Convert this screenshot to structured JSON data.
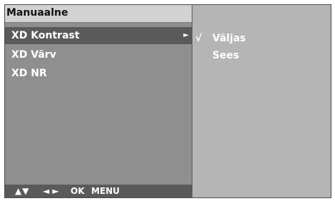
{
  "title": "Manuaalne",
  "menu": {
    "items": [
      {
        "label": "XD Kontrast",
        "selected": true,
        "arrow": "►"
      },
      {
        "label": "XD Värv"
      },
      {
        "label": "XD NR"
      }
    ]
  },
  "options": {
    "items": [
      {
        "label": "Väljas",
        "check": "√"
      },
      {
        "label": "Sees",
        "check": ""
      }
    ]
  },
  "hints": {
    "updown": "▲▼",
    "leftright": "◄ ►",
    "ok": "OK",
    "menu": "MENU"
  }
}
